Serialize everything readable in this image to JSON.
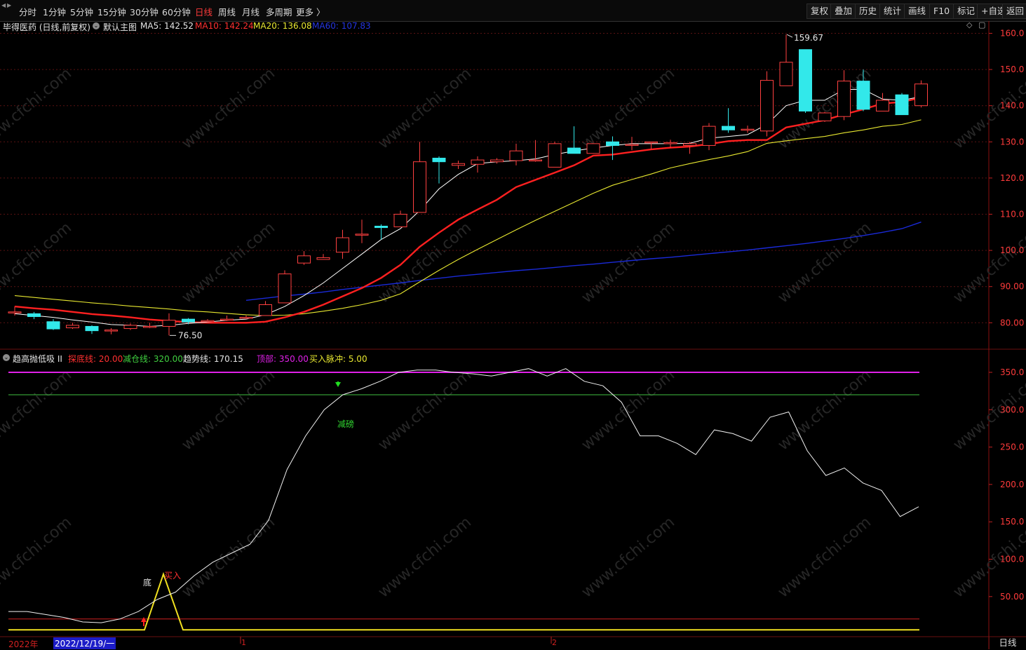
{
  "toolbar": {
    "periods": [
      "分时",
      "1分钟",
      "5分钟",
      "15分钟",
      "30分钟",
      "60分钟",
      "日线",
      "周线",
      "月线",
      "多周期",
      "更多 〉"
    ],
    "active_period": "日线",
    "right_buttons": [
      "复权",
      "叠加",
      "历史",
      "统计",
      "画线",
      "F10",
      "标记",
      "+自选",
      "返回"
    ]
  },
  "main_panel": {
    "title": "毕得医药 (日线,前复权)",
    "template_label": "默认主图",
    "ma5": "MA5: 142.52",
    "ma10": "MA10: 142.24",
    "ma20": "MA20: 136.08",
    "ma60": "MA60: 107.83",
    "high_label": "159.67",
    "low_label": "76.50",
    "y_ticks": [
      "160.0",
      "150.0",
      "140.0",
      "130.0",
      "120.0",
      "110.0",
      "100.0",
      "90.00",
      "80.00"
    ]
  },
  "indicator_panel": {
    "name": "趋高抛低吸 II",
    "explore_line": "探底线: 20.00",
    "reduce_line": "减仓线: 320.00",
    "trend_line": "趋势线: 170.15",
    "top_line": "顶部: 350.00",
    "buy_pulse": "买入脉冲: 5.00",
    "reduce_label": "减磅",
    "bottom_label": "底",
    "buy_label": "买入",
    "y_ticks": [
      "350.0",
      "300.0",
      "250.0",
      "200.0",
      "150.0",
      "100.0",
      "50.00"
    ]
  },
  "bottom": {
    "year": "2022年",
    "cursor_date": "2022/12/19/一",
    "month1": "1",
    "month2": "2",
    "period": "日线"
  },
  "watermark": "www.cfchi.com",
  "colors": {
    "up": "#ff4040",
    "down": "#32e8ea",
    "ma5": "#ffffff",
    "ma10": "#ff2020",
    "ma20": "#e8e830",
    "ma60": "#1a2ad8",
    "top_line": "#e020e8",
    "reduce_line": "#40c040",
    "explore_line": "#d02020"
  },
  "chart_data": {
    "type": "candlestick",
    "price_range": [
      76.5,
      159.67
    ],
    "candles": [
      {
        "o": 83,
        "c": 83,
        "h": 84.5,
        "l": 82
      },
      {
        "o": 82.5,
        "c": 81.7,
        "h": 83,
        "l": 81
      },
      {
        "o": 80.3,
        "c": 78.3,
        "h": 81,
        "l": 78
      },
      {
        "o": 78.6,
        "c": 79.3,
        "h": 80,
        "l": 78.3
      },
      {
        "o": 79,
        "c": 77.8,
        "h": 79.3,
        "l": 76.9
      },
      {
        "o": 78,
        "c": 78,
        "h": 78.5,
        "l": 76.8
      },
      {
        "o": 78.4,
        "c": 79.3,
        "h": 79.8,
        "l": 78
      },
      {
        "o": 79,
        "c": 79,
        "h": 80,
        "l": 78.5
      },
      {
        "o": 79,
        "c": 80.7,
        "h": 82.6,
        "l": 76.5
      },
      {
        "o": 81,
        "c": 80.2,
        "h": 81.3,
        "l": 79.6
      },
      {
        "o": 80.6,
        "c": 80.6,
        "h": 81,
        "l": 80.2
      },
      {
        "o": 81,
        "c": 81,
        "h": 82,
        "l": 80.5
      },
      {
        "o": 81.5,
        "c": 81.5,
        "h": 82,
        "l": 81
      },
      {
        "o": 82,
        "c": 85,
        "h": 86,
        "l": 82
      },
      {
        "o": 85.5,
        "c": 93.5,
        "h": 94.5,
        "l": 85.5
      },
      {
        "o": 96.5,
        "c": 98.5,
        "h": 99.8,
        "l": 96
      },
      {
        "o": 97.5,
        "c": 98,
        "h": 99,
        "l": 97.5
      },
      {
        "o": 99.5,
        "c": 103.5,
        "h": 105.7,
        "l": 97.7
      },
      {
        "o": 104.3,
        "c": 104.5,
        "h": 108.5,
        "l": 102
      },
      {
        "o": 106.7,
        "c": 106.3,
        "h": 107.2,
        "l": 103
      },
      {
        "o": 106.5,
        "c": 110,
        "h": 111,
        "l": 106.5
      },
      {
        "o": 110.5,
        "c": 124.5,
        "h": 130,
        "l": 110.5
      },
      {
        "o": 125.5,
        "c": 124.5,
        "h": 126,
        "l": 118.5
      },
      {
        "o": 123.5,
        "c": 124,
        "h": 124.8,
        "l": 122.5
      },
      {
        "o": 123.8,
        "c": 125,
        "h": 126,
        "l": 121.5
      },
      {
        "o": 124.5,
        "c": 125,
        "h": 125.5,
        "l": 124
      },
      {
        "o": 124.8,
        "c": 127.5,
        "h": 129.5,
        "l": 123.5
      },
      {
        "o": 125,
        "c": 125,
        "h": 130.5,
        "l": 124.5
      },
      {
        "o": 123,
        "c": 129.5,
        "h": 130,
        "l": 123
      },
      {
        "o": 128.3,
        "c": 126.8,
        "h": 134.3,
        "l": 126.8
      },
      {
        "o": 126.8,
        "c": 129.5,
        "h": 129.5,
        "l": 126.8
      },
      {
        "o": 130,
        "c": 129,
        "h": 131.5,
        "l": 125
      },
      {
        "o": 129,
        "c": 129.3,
        "h": 131.4,
        "l": 127.7
      },
      {
        "o": 129.8,
        "c": 130,
        "h": 130,
        "l": 128
      },
      {
        "o": 129.5,
        "c": 129.8,
        "h": 130.6,
        "l": 128.3
      },
      {
        "o": 129,
        "c": 129.5,
        "h": 130,
        "l": 126.7
      },
      {
        "o": 129,
        "c": 134.3,
        "h": 135.2,
        "l": 127.7
      },
      {
        "o": 134.3,
        "c": 133.3,
        "h": 139.3,
        "l": 132.5
      },
      {
        "o": 133.3,
        "c": 133.5,
        "h": 134.5,
        "l": 132.5
      },
      {
        "o": 133,
        "c": 147,
        "h": 149.5,
        "l": 131.5
      },
      {
        "o": 145.5,
        "c": 152,
        "h": 159.67,
        "l": 145.5
      },
      {
        "o": 155.5,
        "c": 138.5,
        "h": 155.5,
        "l": 138
      },
      {
        "o": 135.8,
        "c": 138,
        "h": 138.3,
        "l": 135.5
      },
      {
        "o": 137,
        "c": 146.8,
        "h": 149.8,
        "l": 136
      },
      {
        "o": 146.8,
        "c": 139,
        "h": 150,
        "l": 138.5
      },
      {
        "o": 138.5,
        "c": 141.5,
        "h": 143.5,
        "l": 138.5
      },
      {
        "o": 143,
        "c": 137.5,
        "h": 143.5,
        "l": 137.5
      },
      {
        "o": 140,
        "c": 146,
        "h": 147,
        "l": 139.5
      }
    ],
    "ma5": [
      82.5,
      82,
      81.5,
      80.8,
      80.2,
      79.5,
      79.3,
      79,
      79.3,
      79.8,
      80.2,
      80.7,
      81,
      82.2,
      84.5,
      87.5,
      91,
      95,
      99,
      103,
      106,
      111,
      117,
      121,
      124,
      124.5,
      124.8,
      125.3,
      126.5,
      127.5,
      128.3,
      129,
      129.5,
      129.5,
      129.5,
      129.6,
      131,
      131.5,
      132,
      134.8,
      140,
      141.5,
      141.5,
      144.5,
      144.5,
      141.8,
      141.5,
      142.52
    ],
    "ma10": [
      84.5,
      84,
      83.6,
      83,
      82.4,
      82,
      81.5,
      80.9,
      80.5,
      80.2,
      80,
      80,
      80,
      80.3,
      81.5,
      83,
      85,
      87.3,
      89.6,
      92.4,
      96,
      101,
      104.9,
      108.5,
      111.3,
      114,
      117.5,
      119.5,
      121.5,
      123.5,
      126.2,
      126.5,
      127.2,
      127.9,
      128.4,
      128.7,
      129.4,
      130.2,
      130.5,
      130.5,
      134,
      135,
      136,
      137.6,
      139,
      140.6,
      141,
      142.24
    ],
    "ma20": [
      87.5,
      87,
      86.5,
      86,
      85.5,
      85.1,
      84.6,
      84.2,
      83.8,
      83.3,
      83,
      82.6,
      82.2,
      82,
      82.1,
      82.5,
      83.2,
      84,
      85,
      86.2,
      88,
      91.3,
      94.5,
      97.5,
      100.3,
      103,
      105.7,
      108.3,
      110.8,
      113.3,
      115.8,
      118,
      119.6,
      121.1,
      122.8,
      124,
      125.1,
      126.1,
      127.3,
      129.6,
      130.3,
      130.9,
      131.5,
      132.5,
      133.3,
      134.3,
      134.8,
      136.08
    ],
    "ma60": [
      null,
      null,
      null,
      null,
      null,
      null,
      null,
      null,
      null,
      null,
      null,
      null,
      86.2,
      86.8,
      87.4,
      87.9,
      88.5,
      89.2,
      89.8,
      90.4,
      91,
      91.7,
      92.3,
      92.9,
      93.4,
      93.9,
      94.4,
      94.8,
      95.3,
      95.8,
      96.2,
      96.7,
      97.2,
      97.7,
      98.1,
      98.6,
      99.1,
      99.6,
      100.1,
      100.7,
      101.3,
      101.9,
      102.6,
      103.3,
      104.1,
      105,
      106,
      107.83
    ],
    "indicator_trend": [
      30,
      30,
      26,
      22,
      16,
      15,
      20,
      30,
      46,
      56,
      78,
      96,
      108,
      120,
      152,
      220,
      265,
      300,
      320,
      328,
      338,
      350,
      353,
      353,
      350,
      348,
      345,
      350,
      355,
      345,
      355,
      338,
      332,
      310,
      265,
      265,
      255,
      240,
      273,
      268,
      258,
      290,
      297,
      245,
      212,
      222,
      202,
      192,
      157,
      170.15
    ],
    "indicator_x_dates": "2022/12 - 2023/02"
  }
}
